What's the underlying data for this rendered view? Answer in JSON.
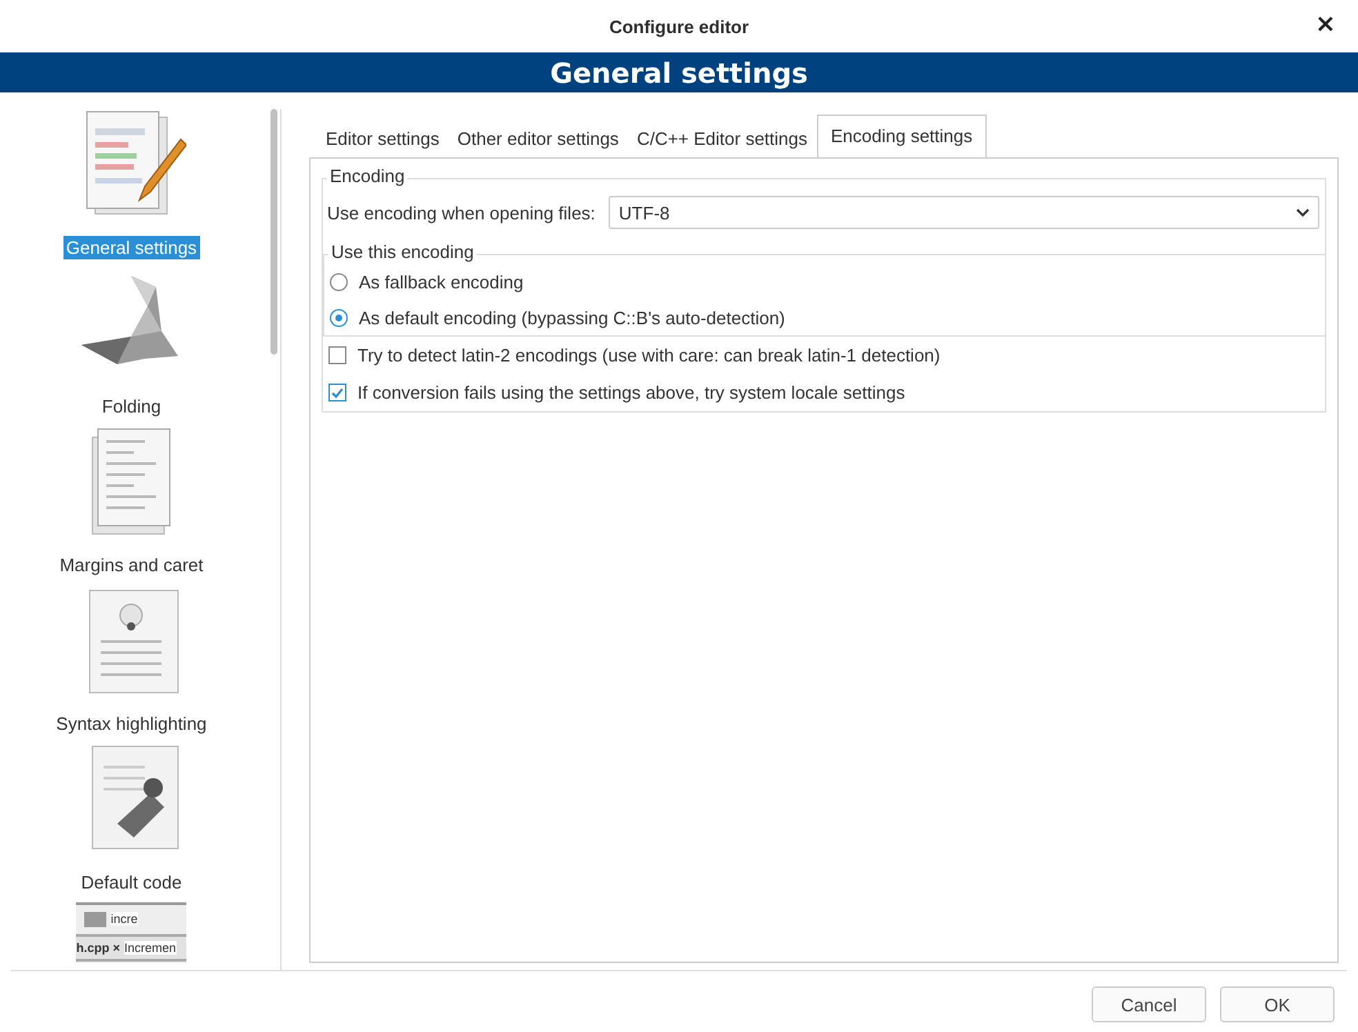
{
  "window": {
    "title": "Configure editor",
    "close": "×"
  },
  "banner": {
    "title": "General settings"
  },
  "sidebar": {
    "items": [
      {
        "kind": "document-pencil",
        "label": "General settings",
        "selected": true
      },
      {
        "kind": "origami",
        "label": "Folding",
        "selected": false
      },
      {
        "kind": "pages",
        "label": "Margins and caret",
        "selected": false
      },
      {
        "kind": "bulb-document",
        "label": "Syntax highlighting",
        "selected": false
      },
      {
        "kind": "stamp-document",
        "label": "Default code",
        "selected": false
      },
      {
        "kind": "toolbar-preview",
        "preview_texts": [
          "incre",
          "h.cpp ×",
          "Incremen"
        ]
      }
    ]
  },
  "tabs": [
    {
      "label": "Editor settings",
      "selected": false
    },
    {
      "label": "Other editor settings",
      "selected": false
    },
    {
      "label": "C/C++ Editor settings",
      "selected": false
    },
    {
      "label": "Encoding settings",
      "selected": true
    }
  ],
  "encoding_group": {
    "title": "Encoding",
    "combo_label": "Use encoding when opening files:",
    "combo_value": "UTF-8",
    "subgroup": {
      "title": "Use this encoding",
      "radios": [
        {
          "label": "As fallback encoding",
          "selected": false
        },
        {
          "label": "As default encoding (bypassing C::B's auto-detection)",
          "selected": true
        }
      ]
    },
    "checkboxes": [
      {
        "label": "Try to detect latin-2 encodings (use with care: can break latin-1 detection)",
        "checked": false
      },
      {
        "label": "If conversion fails using the settings above, try system locale settings",
        "checked": true
      }
    ]
  },
  "buttons": [
    {
      "label": "Cancel"
    },
    {
      "label": "OK"
    }
  ]
}
